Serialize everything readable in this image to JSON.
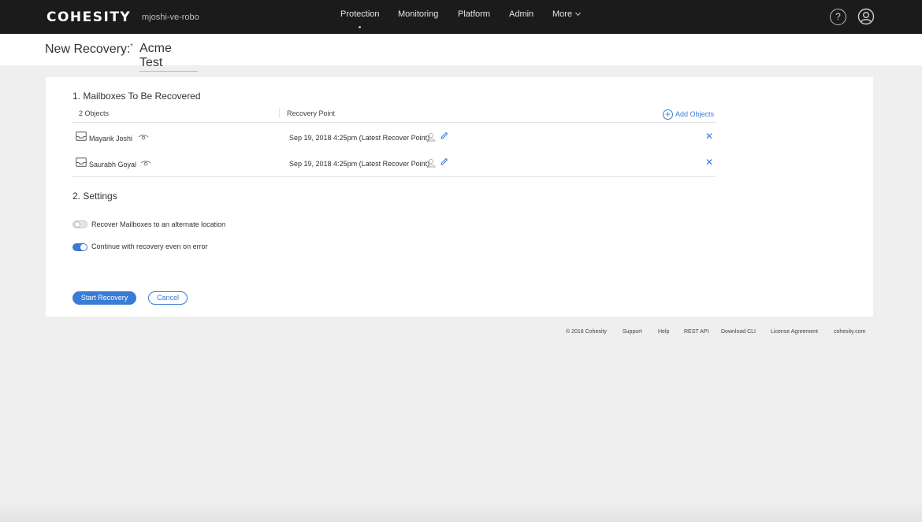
{
  "app": {
    "logo": "COHESITY",
    "cluster_name": "mjoshi-ve-robo"
  },
  "nav": {
    "items": [
      "Protection",
      "Monitoring",
      "Platform",
      "Admin",
      "More"
    ],
    "active": "Protection",
    "help_label": "?"
  },
  "title": {
    "prefix": "New Recovery:",
    "required_mark": "*",
    "name": "Acme Test"
  },
  "mailboxes": {
    "heading": "1. Mailboxes To Be Recovered",
    "count_label": "2 Objects",
    "recovery_point_header": "Recovery Point",
    "add_objects": "Add Objects",
    "rows": [
      {
        "name": "Mayank Joshi",
        "recovery_point": "Sep 19, 2018 4:25pm (Latest Recover Point)"
      },
      {
        "name": "Saurabh Goyal",
        "recovery_point": "Sep 19, 2018 4:25pm (Latest Recover Point)"
      }
    ],
    "remove_glyph": "✕"
  },
  "settings": {
    "heading": "2. Settings",
    "options": [
      {
        "label": "Recover Mailboxes to an alternate location",
        "enabled": false
      },
      {
        "label": "Continue with recovery even on error",
        "enabled": true
      }
    ]
  },
  "actions": {
    "start": "Start Recovery",
    "cancel": "Cancel"
  },
  "footer": {
    "copyright": "© 2018 Cohesity",
    "links": [
      "Support",
      "Help",
      "REST API",
      "Download CLI",
      "License Agreement",
      "cohesity.com"
    ]
  },
  "colors": {
    "accent": "#3a7bd5",
    "topbar": "#1b1b1b",
    "page_bg": "#efefef"
  }
}
